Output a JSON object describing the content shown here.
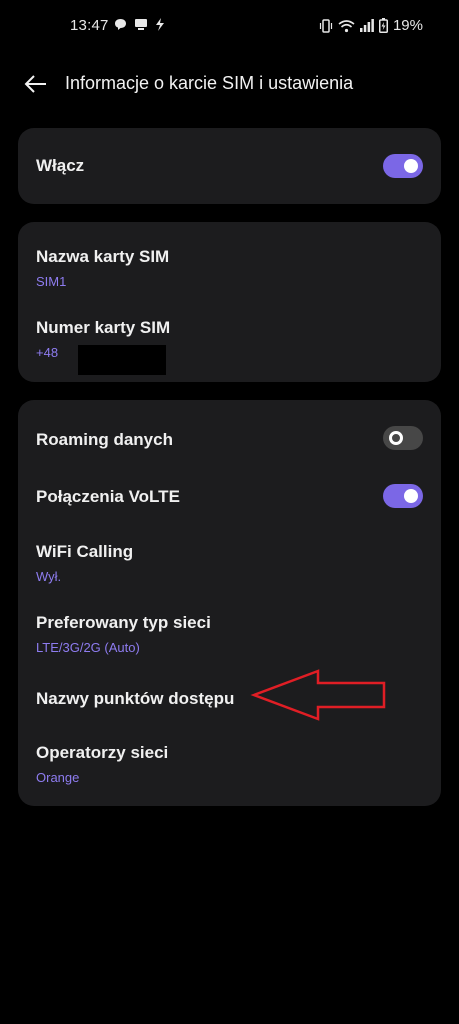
{
  "status_bar": {
    "time": "13:47",
    "battery": "19%",
    "icons": [
      "message-icon",
      "cast-icon",
      "flash-icon",
      "vibrate-icon",
      "wifi-icon",
      "signal-icon",
      "battery-icon"
    ]
  },
  "header": {
    "back_icon": "arrow-left-icon",
    "title": "Informacje o karcie SIM i ustawienia"
  },
  "card1": {
    "enable": {
      "label": "Włącz",
      "on": true
    }
  },
  "card2": {
    "sim_name": {
      "label": "Nazwa karty SIM",
      "value": "SIM1"
    },
    "sim_number": {
      "label": "Numer karty SIM",
      "value": "+48"
    }
  },
  "card3": {
    "roaming": {
      "label": "Roaming danych",
      "on": false
    },
    "volte": {
      "label": "Połączenia VoLTE",
      "on": true
    },
    "wifi_calling": {
      "label": "WiFi Calling",
      "value": "Wył."
    },
    "network_type": {
      "label": "Preferowany typ sieci",
      "value": "LTE/3G/2G (Auto)"
    },
    "apn": {
      "label": "Nazwy punktów dostępu"
    },
    "operators": {
      "label": "Operatorzy sieci",
      "value": "Orange"
    }
  },
  "colors": {
    "background": "#000000",
    "card": "#1c1c1e",
    "accent": "#7b67e6",
    "subtext": "#8e7cf0",
    "annotation": "#e01e25"
  }
}
